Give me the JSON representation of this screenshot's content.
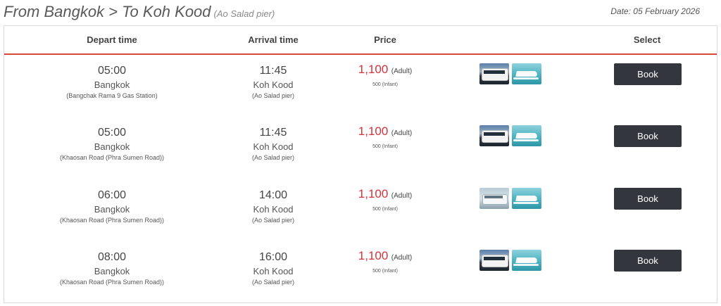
{
  "route": {
    "title": "From Bangkok > To Koh Kood",
    "subtitle": "(Ao Salad pier)",
    "date": "Date: 05 February 2026"
  },
  "columns": {
    "depart": "Depart time",
    "arrive": "Arrival time",
    "price": "Price",
    "select": "Select"
  },
  "trips": [
    {
      "depart_time": "05:00",
      "depart_city": "Bangkok",
      "depart_place": "(Bangchak Rama 9 Gas Station)",
      "arrive_time": "11:45",
      "arrive_city": "Koh Kood",
      "arrive_place": "(Ao Salad pier)",
      "price": "1,100",
      "price_unit": "(Adult)",
      "infant": "500 (Infant)",
      "vehicles": [
        "bus-icon",
        "speedboat-icon"
      ],
      "book_label": "Book"
    },
    {
      "depart_time": "05:00",
      "depart_city": "Bangkok",
      "depart_place": "(Khaosan Road (Phra Sumen Road))",
      "arrive_time": "11:45",
      "arrive_city": "Koh Kood",
      "arrive_place": "(Ao Salad pier)",
      "price": "1,100",
      "price_unit": "(Adult)",
      "infant": "500 (Infant)",
      "vehicles": [
        "bus-icon",
        "speedboat-icon"
      ],
      "book_label": "Book"
    },
    {
      "depart_time": "06:00",
      "depart_city": "Bangkok",
      "depart_place": "(Khaosan Road (Phra Sumen Road))",
      "arrive_time": "14:00",
      "arrive_city": "Koh Kood",
      "arrive_place": "(Ao Salad pier)",
      "price": "1,100",
      "price_unit": "(Adult)",
      "infant": "500 (Infant)",
      "vehicles": [
        "van-icon",
        "speedboat-icon"
      ],
      "book_label": "Book"
    },
    {
      "depart_time": "08:00",
      "depart_city": "Bangkok",
      "depart_place": "(Khaosan Road (Phra Sumen Road))",
      "arrive_time": "16:00",
      "arrive_city": "Koh Kood",
      "arrive_place": "(Ao Salad pier)",
      "price": "1,100",
      "price_unit": "(Adult)",
      "infant": "500 (Infant)",
      "vehicles": [
        "bus-icon",
        "speedboat-icon"
      ],
      "book_label": "Book"
    }
  ],
  "colors": {
    "accent_red": "#d9323a",
    "button_dark": "#33373d",
    "header_rule": "#d9463b"
  }
}
